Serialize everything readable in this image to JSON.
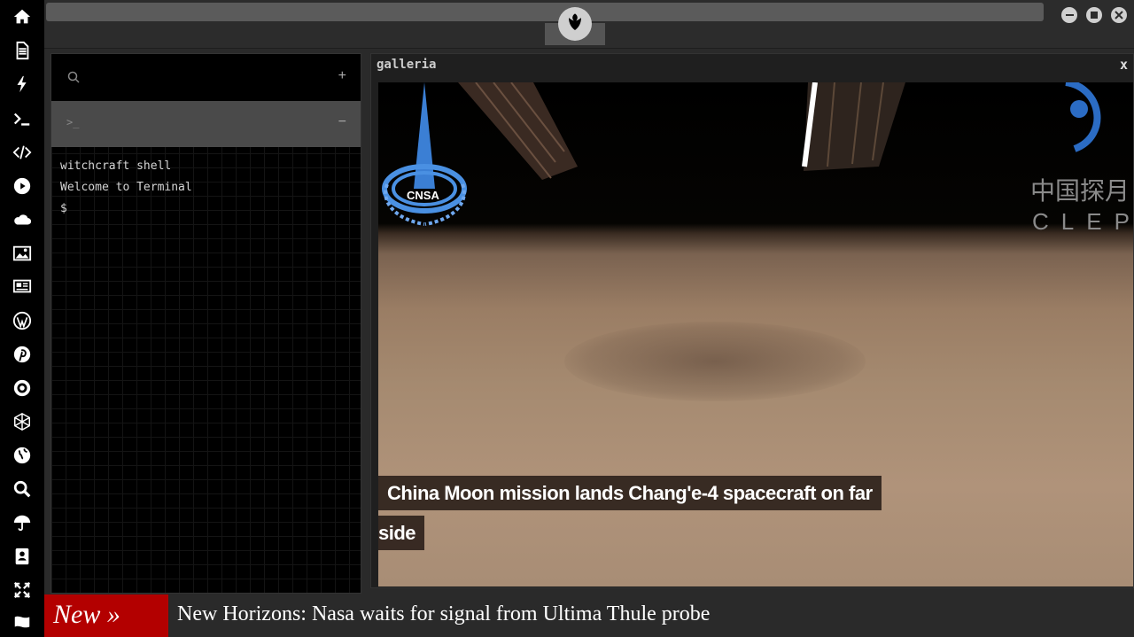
{
  "rail": {
    "icons": [
      "home-icon",
      "document-icon",
      "bolt-icon",
      "terminal-icon",
      "code-icon",
      "play-icon",
      "cloud-icon",
      "image-icon",
      "newspaper-icon",
      "wordpress-icon",
      "pinterest-icon",
      "galactic-empire-icon",
      "jedi-icon",
      "globe-icon",
      "search-icon",
      "umbrella-icon",
      "address-book-icon",
      "expand-icon",
      "flag-icon"
    ]
  },
  "terminal": {
    "search_icon": "search-icon",
    "add_label": "+",
    "tab_prompt": ">_",
    "collapse_label": "−",
    "lines": [
      "witchcraft shell",
      "Welcome to Terminal",
      "$"
    ]
  },
  "galleria": {
    "title": "galleria",
    "close_label": "x",
    "caption_line1": "China Moon mission lands Chang'e-4 spacecraft on far",
    "caption_line2": "side",
    "image_text_left": "CNSA",
    "image_text_right1": "中国探月",
    "image_text_right2": "CLEP"
  },
  "ticker": {
    "label": "New »",
    "headline": "New Horizons: Nasa waits for signal from Ultima Thule probe"
  },
  "colors": {
    "rail_bg": "#000000",
    "ticker_label_bg": "#b30000",
    "panel_bg": "#000000"
  }
}
